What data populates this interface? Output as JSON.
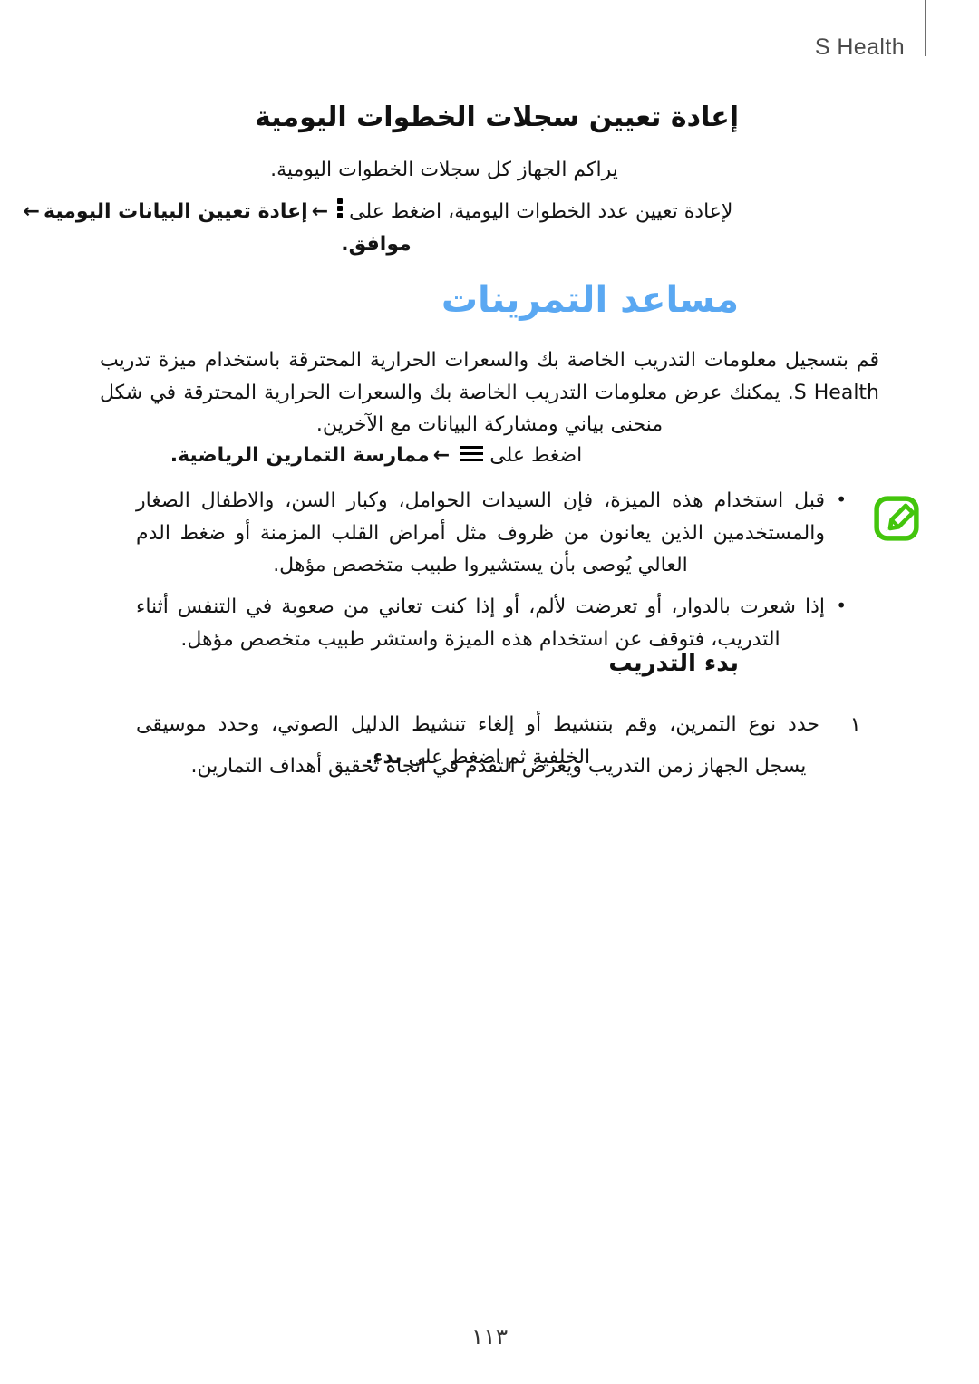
{
  "document": {
    "header_title": "S Health",
    "page_number": "١١٣"
  },
  "sections": {
    "reset_steps": {
      "heading": "إعادة تعيين سجلات الخطوات اليومية",
      "paragraph": "يراكم الجهاز كل سجلات الخطوات اليومية.",
      "instruction_prefix": "لإعادة تعيين عدد الخطوات اليومية، اضغط على",
      "instruction_icon": "kebab-menu-icon",
      "instruction_arrow_1": "←",
      "instruction_bold_1": "إعادة تعيين البيانات اليومية",
      "instruction_arrow_2": "←",
      "instruction_bold_2": "موافق."
    },
    "exercise_mate": {
      "title": "مساعد التمرينات",
      "title_color": "#5aa8f2",
      "paragraph": "قم بتسجيل معلومات التدريب الخاصة بك والسعرات الحرارية المحترقة باستخدام ميزة تدريب S Health. يمكنك عرض معلومات التدريب الخاصة بك والسعرات الحرارية المحترقة في شكل منحنى بياني ومشاركة البيانات مع الآخرين.",
      "instruction_prefix": "اضغط على",
      "instruction_icon": "hamburger-menu-icon",
      "instruction_arrow": "←",
      "instruction_bold": "ممارسة التمارين الرياضية."
    },
    "note": {
      "icon": "note-pencil-icon",
      "icon_color": "#43c50c",
      "items": [
        "قبل استخدام هذه الميزة، فإن السيدات الحوامل، وكبار السن، والاطفال الصغار والمستخدمين الذين يعانون من ظروف مثل أمراض القلب المزمنة أو ضغط الدم العالي يُوصى بأن يستشيروا طبيب متخصص مؤهل.",
        "إذا شعرت بالدوار، أو تعرضت لألم، أو إذا كنت تعاني من صعوبة في التنفس أثناء التدريب، فتوقف عن استخدام هذه الميزة واستشر طبيب متخصص مؤهل."
      ]
    },
    "start_training": {
      "heading": "بدء التدريب",
      "steps": [
        {
          "number": "١",
          "text_before_bold": "حدد نوع التمرين، وقم بتنشيط أو إلغاء تنشيط الدليل الصوتي، وحدد موسيقى الخلفية ثم اضغط على",
          "bold": "بدء."
        }
      ],
      "step_note": "يسجل الجهاز زمن التدريب ويعرض التقدم في اتجاه تحقيق أهداف التمارين."
    }
  }
}
